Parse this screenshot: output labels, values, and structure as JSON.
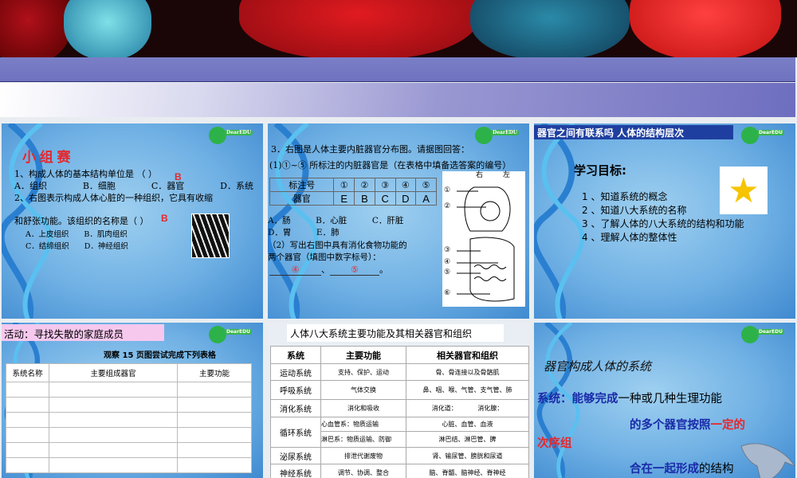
{
  "slide1": {
    "title": "小 组 赛",
    "q1": "1、构成人体的基本结构单位是 （      ）",
    "q1_answer": "B",
    "q1_options": [
      "A．组织",
      "B．细胞",
      "C．器官",
      "D．系统"
    ],
    "q2_line1": "2、右图表示构成人体心脏的一种组织，它具有收缩",
    "q2_line2": "和舒张功能。该组织的名称是（      ）",
    "q2_answer": "B",
    "q2_options": [
      "A．上皮组织",
      "B．肌肉组织",
      "C．结缔组织",
      "D．神经组织"
    ]
  },
  "slide2": {
    "q3": "3．右图是人体主要内脏器官分布图。请据图回答：",
    "q3_1": "(1)①~⑤ 所标注的内脏器官是（在表格中填备选答案的编号）",
    "table_header": [
      "标注号",
      "①",
      "②",
      "③",
      "④",
      "⑤"
    ],
    "table_row_label": "器官",
    "table_answers": [
      "E",
      "B",
      "C",
      "D",
      "A"
    ],
    "options": [
      "A．肠",
      "B．心脏",
      "C．肝脏",
      "D．胃",
      "E．肺"
    ],
    "q3_2_line1": "（2）写出右图中具有消化食物功能的",
    "q3_2_line2": "两个器官（填图中数字标号）：",
    "answer1": "④",
    "answer2": "⑤",
    "sep": "、",
    "end": "。",
    "diagram_top": [
      "右",
      "左"
    ],
    "diagram_labels": [
      "①",
      "②",
      "③",
      "④",
      "⑤",
      "⑥"
    ]
  },
  "slide3": {
    "title": "器官之间有联系吗 人体的结构层次",
    "subtitle": "学习目标:",
    "goals": [
      "1 、知道系统的概念",
      "2 、知道八大系统的名称",
      "3 、了解人体的八大系统的结构和功能",
      "4 、理解人体的整体性"
    ]
  },
  "slide4": {
    "title": "活动：寻找失散的家庭成员",
    "subtitle": "观察 15 页图尝试完成下列表格",
    "headers": [
      "系统名称",
      "主要组成器官",
      "主要功能"
    ]
  },
  "slide5": {
    "title": "人体八大系统主要功能及其相关器官和组织",
    "headers": [
      "系统",
      "主要功能",
      "相关器官和组织"
    ],
    "rows": [
      {
        "system": "运动系统",
        "function": "支持、保护、运动",
        "organs": "骨、骨连接以及骨骼肌"
      },
      {
        "system": "呼吸系统",
        "function": "气体交换",
        "organs": "鼻、咽、喉、气管、支气管、肺"
      },
      {
        "system": "消化系统",
        "function": "消化和吸收",
        "organs": "消化道：          消化腺："
      },
      {
        "system": "循环系统",
        "function": "心血管系：物质运输",
        "organs": "心脏、血管、血液"
      },
      {
        "system": "",
        "function": "淋巴系：物质运输、防御",
        "organs": "淋巴结、淋巴管、脾"
      },
      {
        "system": "泌尿系统",
        "function": "排泄代谢废物",
        "organs": "肾、输尿管、膀胱和尿道"
      },
      {
        "system": "神经系统",
        "function": "调节、协调、整合",
        "organs": "脑、脊髓、脑神经、脊神经"
      }
    ]
  },
  "slide6": {
    "title": "器官构成人体的系统",
    "l1a": "系统：",
    "l1b": "能够完成",
    "l1c": "一种或几种生理功能",
    "l2a": "的多个器官",
    "l2b": "按照",
    "l2c": "一定的",
    "l3": "次序组",
    "l4a": "合在一起形成",
    "l4b": "的结构"
  },
  "colors": {
    "red": "#e8262b",
    "navy": "#1a2aa8",
    "title_bar": "#1f3fa0",
    "pink": "#f6c8ee"
  }
}
